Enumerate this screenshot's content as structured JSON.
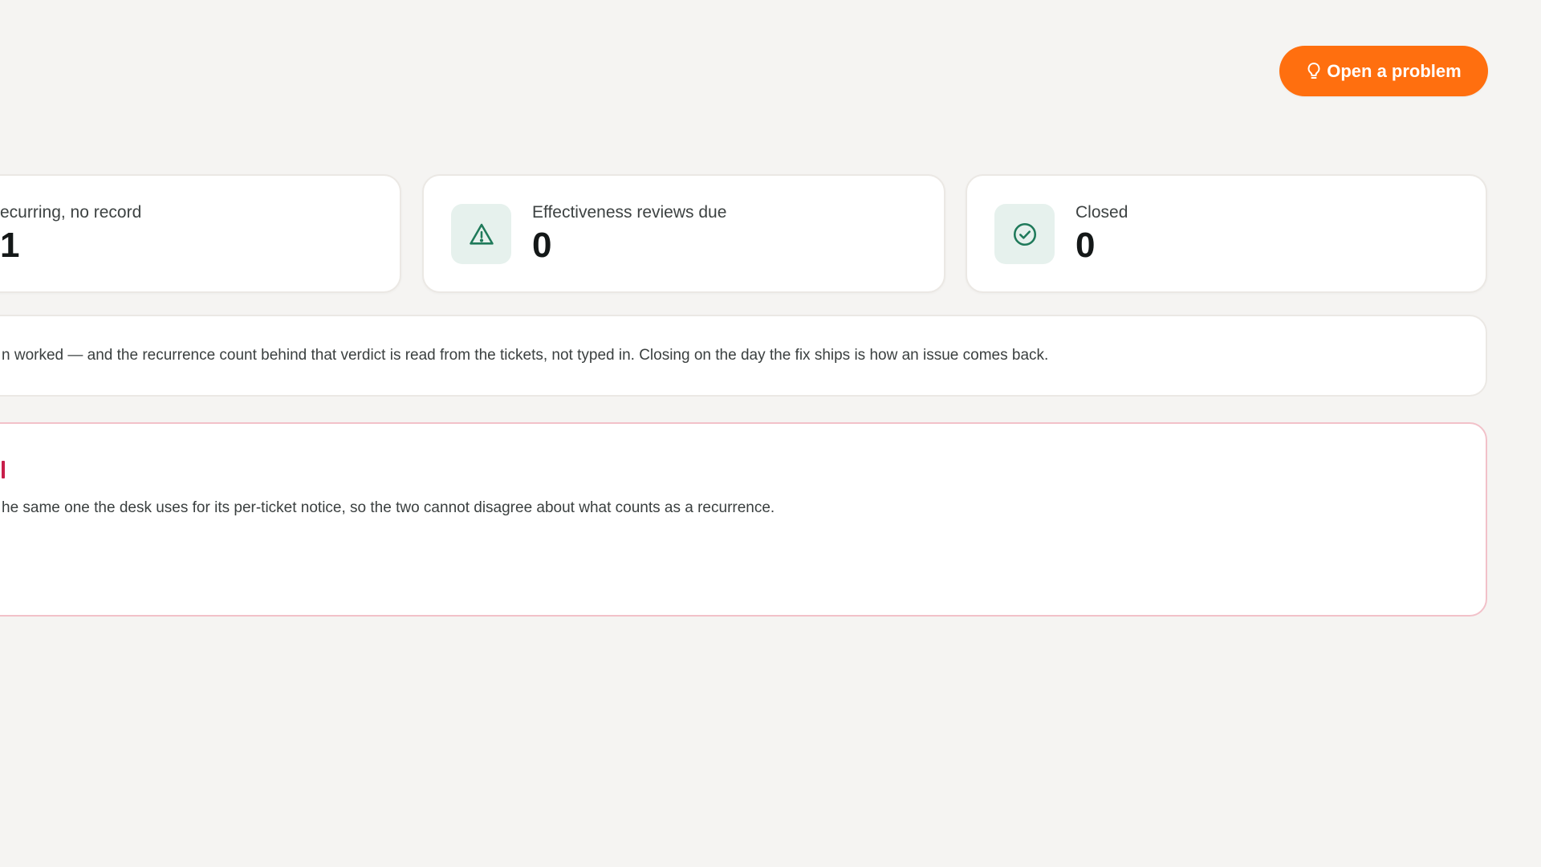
{
  "header": {
    "open_problem_label": "Open a problem",
    "open_problem_icon": "lightbulb-icon"
  },
  "stats": [
    {
      "label": "ecurring, no record",
      "value": "1",
      "icon": ""
    },
    {
      "label": "Effectiveness reviews due",
      "value": "0",
      "icon": "warning-triangle-icon"
    },
    {
      "label": "Closed",
      "value": "0",
      "icon": "check-circle-icon"
    }
  ],
  "info_banner": {
    "text": "n worked — and the recurrence count behind that verdict is read from the tickets, not typed in. Closing on the day the fix ships is how an issue comes back."
  },
  "alert_panel": {
    "text": "he same one the desk uses for its per-ticket notice, so the two cannot disagree about what counts as a recurrence."
  },
  "colors": {
    "accent": "#ff6f0f",
    "icon_green": "#1f7a5a",
    "icon_bg": "#e6f1ed",
    "alert_border": "#f2c1c9",
    "alert_accent": "#c81e4a",
    "background": "#f5f4f2"
  }
}
